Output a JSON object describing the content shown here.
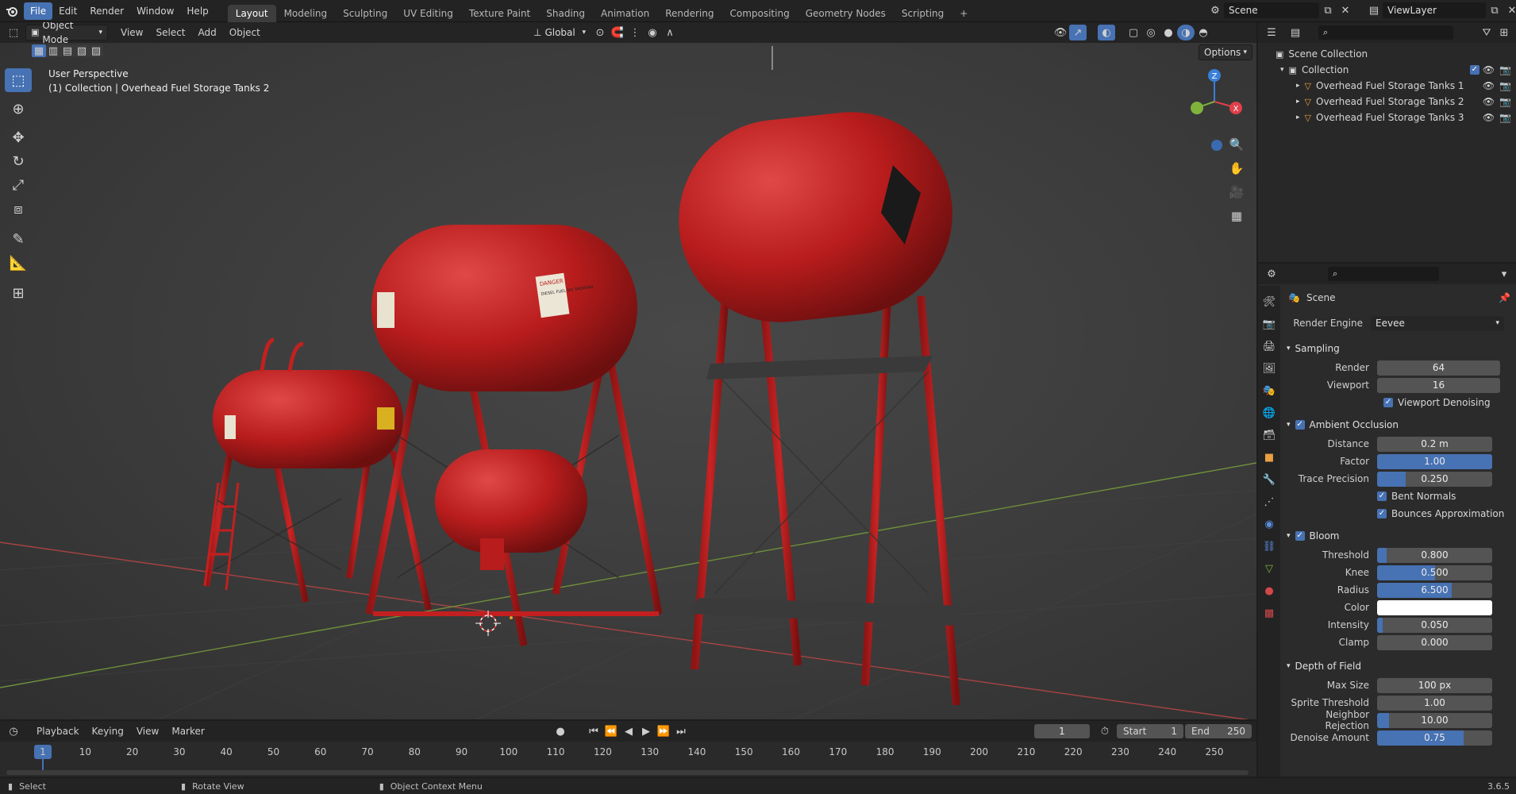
{
  "menu": {
    "items": [
      "File",
      "Edit",
      "Render",
      "Window",
      "Help"
    ],
    "active_index": 0
  },
  "workspaces": {
    "tabs": [
      "Layout",
      "Modeling",
      "Sculpting",
      "UV Editing",
      "Texture Paint",
      "Shading",
      "Animation",
      "Rendering",
      "Compositing",
      "Geometry Nodes",
      "Scripting"
    ],
    "active_index": 0,
    "add_label": "+"
  },
  "scene_field": "Scene",
  "viewlayer_field": "ViewLayer",
  "viewport": {
    "mode": "Object Mode",
    "menus": [
      "View",
      "Select",
      "Add",
      "Object"
    ],
    "transform_orientation": "Global",
    "options_label": "Options",
    "overlay_title": "User Perspective",
    "overlay_subtitle": "(1) Collection | Overhead Fuel Storage Tanks 2",
    "gizmo": {
      "z": "Z",
      "x": "X"
    }
  },
  "tank_labels": {
    "warning_title": "DANGER",
    "warning_body": "DIESEL FUEL NO SMOKING"
  },
  "outliner": {
    "root": "Scene Collection",
    "collection": "Collection",
    "objects": [
      "Overhead Fuel Storage Tanks 1",
      "Overhead Fuel Storage Tanks 2",
      "Overhead Fuel Storage Tanks 3"
    ]
  },
  "properties": {
    "context": "Scene",
    "render_engine_label": "Render Engine",
    "render_engine": "Eevee",
    "sampling": {
      "title": "Sampling",
      "render_label": "Render",
      "render": "64",
      "viewport_label": "Viewport",
      "viewport": "16",
      "denoise_label": "Viewport Denoising"
    },
    "ao": {
      "title": "Ambient Occlusion",
      "distance_label": "Distance",
      "distance": "0.2 m",
      "factor_label": "Factor",
      "factor": "1.00",
      "factor_frac": 1.0,
      "trace_label": "Trace Precision",
      "trace": "0.250",
      "trace_frac": 0.25,
      "bent_label": "Bent Normals",
      "bounces_label": "Bounces Approximation"
    },
    "bloom": {
      "title": "Bloom",
      "threshold_label": "Threshold",
      "threshold": "0.800",
      "threshold_frac": 0.08,
      "knee_label": "Knee",
      "knee": "0.500",
      "knee_frac": 0.5,
      "radius_label": "Radius",
      "radius": "6.500",
      "radius_frac": 0.65,
      "color_label": "Color",
      "color": "#ffffff",
      "intensity_label": "Intensity",
      "intensity": "0.050",
      "intensity_frac": 0.05,
      "clamp_label": "Clamp",
      "clamp": "0.000",
      "clamp_frac": 0.0
    },
    "dof": {
      "title": "Depth of Field",
      "max_size_label": "Max Size",
      "max_size": "100 px",
      "sprite_label": "Sprite Threshold",
      "sprite": "1.00",
      "neighbor_label": "Neighbor Rejection",
      "neighbor": "10.00",
      "neighbor_frac": 0.1,
      "denoise_label": "Denoise Amount",
      "denoise": "0.75",
      "denoise_frac": 0.75
    }
  },
  "timeline": {
    "menus": [
      "Playback",
      "Keying",
      "View",
      "Marker"
    ],
    "current_frame": "1",
    "start_label": "Start",
    "start": "1",
    "end_label": "End",
    "end": "250",
    "ticks": [
      "1",
      "10",
      "20",
      "30",
      "40",
      "50",
      "60",
      "70",
      "80",
      "90",
      "100",
      "110",
      "120",
      "130",
      "140",
      "150",
      "160",
      "170",
      "180",
      "190",
      "200",
      "210",
      "220",
      "230",
      "240",
      "250"
    ]
  },
  "statusbar": {
    "select": "Select",
    "rotate": "Rotate View",
    "context_menu": "Object Context Menu",
    "version": "3.6.5"
  },
  "colors": {
    "accent": "#4772b3",
    "tank_red": "#b81c1c",
    "axis_x": "#e0404a",
    "axis_y": "#7fb33c",
    "axis_z": "#3a7fd8"
  }
}
